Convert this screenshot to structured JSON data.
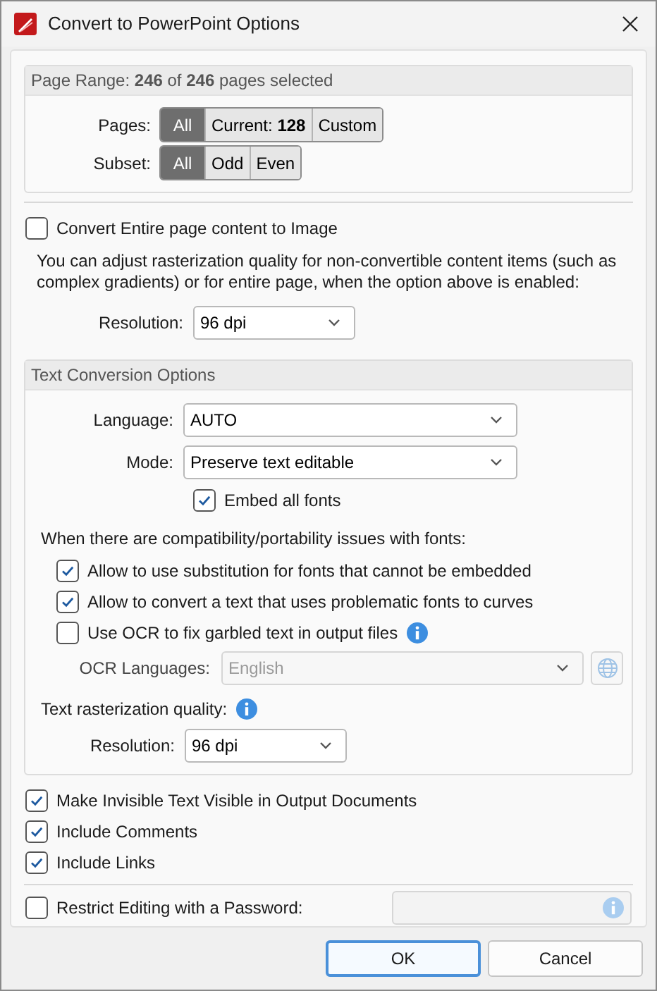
{
  "window": {
    "title": "Convert to PowerPoint Options"
  },
  "page_range": {
    "header": "Page Range: **246** of **246** pages selected",
    "pages": {
      "label": "Pages:",
      "options": [
        {
          "text": "All",
          "selected": true
        },
        {
          "text": "Current: **128**",
          "selected": false
        },
        {
          "text": "Custom",
          "selected": false
        }
      ]
    },
    "subset": {
      "label": "Subset:",
      "options": [
        {
          "text": "All",
          "selected": true
        },
        {
          "text": "Odd",
          "selected": false
        },
        {
          "text": "Even",
          "selected": false
        }
      ]
    }
  },
  "convert_image": {
    "label": "Convert Entire page content to Image",
    "checked": false
  },
  "note": "You can adjust rasterization quality for non-convertible content items (such as complex gradients) or for entire page, when the option above is enabled:",
  "resolution": {
    "label": "Resolution:",
    "value": "96 dpi"
  },
  "text_conversion": {
    "header": "Text Conversion Options",
    "language": {
      "label": "Language:",
      "value": "AUTO"
    },
    "mode": {
      "label": "Mode:",
      "value": "Preserve text editable"
    },
    "embed": {
      "label": "Embed all fonts",
      "checked": true
    },
    "note": "When there are compatibility/portability issues with fonts:",
    "options": [
      {
        "label": "Allow to use substitution for fonts that cannot be embedded",
        "checked": true,
        "info": false
      },
      {
        "label": "Allow to convert a text that uses problematic fonts to curves",
        "checked": true,
        "info": false
      },
      {
        "label": "Use OCR to fix garbled text in output files",
        "checked": false,
        "info": true
      }
    ],
    "ocr_languages": {
      "label": "OCR Languages:",
      "value": "English",
      "disabled": true
    },
    "quality_label": "Text rasterization quality:",
    "resolution": {
      "label": "Resolution:",
      "value": "96 dpi"
    }
  },
  "options": [
    {
      "label": "Make Invisible Text Visible in Output Documents",
      "checked": true
    },
    {
      "label": "Include Comments",
      "checked": true
    },
    {
      "label": "Include Links",
      "checked": true
    }
  ],
  "restrict": {
    "label": "Restrict Editing with a Password:",
    "checked": false
  },
  "buttons": [
    {
      "text": "OK",
      "default": true
    },
    {
      "text": "Cancel",
      "default": false
    }
  ]
}
